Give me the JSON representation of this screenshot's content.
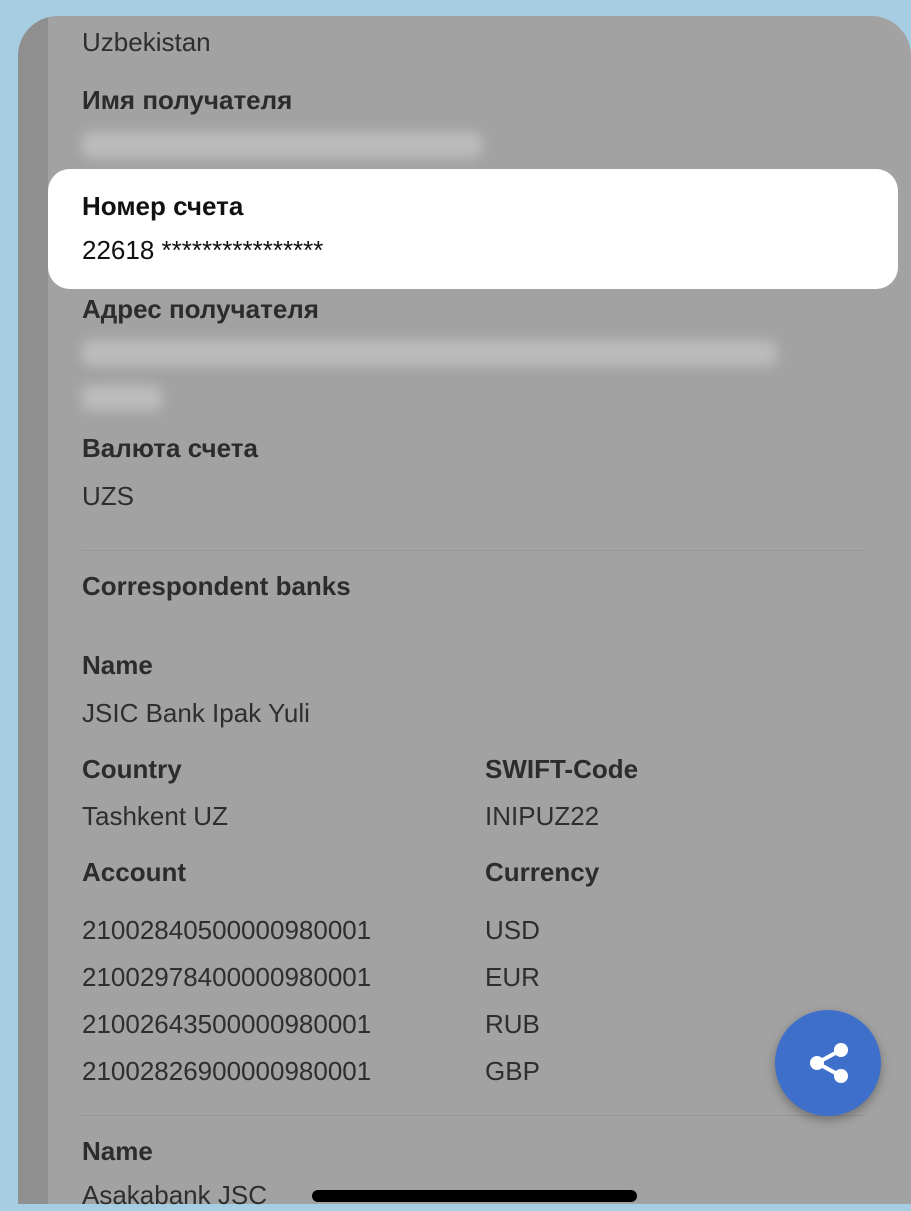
{
  "top_country": "Uzbekistan",
  "recipient_name_label": "Имя получателя",
  "account_number": {
    "label": "Номер счета",
    "value": "22618 ****************"
  },
  "recipient_address_label": "Адрес получателя",
  "account_currency": {
    "label": "Валюта счета",
    "value": "UZS"
  },
  "correspondent_banks": {
    "title": "Correspondent banks",
    "bank1": {
      "name_label": "Name",
      "name_value": "JSIC Bank Ipak Yuli",
      "country_label": "Country",
      "country_value": "Tashkent UZ",
      "swift_label": "SWIFT-Code",
      "swift_value": "INIPUZ22",
      "account_label": "Account",
      "currency_label": "Currency",
      "accounts": [
        {
          "account": "21002840500000980001",
          "currency": "USD"
        },
        {
          "account": "21002978400000980001",
          "currency": "EUR"
        },
        {
          "account": "21002643500000980001",
          "currency": "RUB"
        },
        {
          "account": "21002826900000980001",
          "currency": "GBP"
        }
      ]
    },
    "bank2": {
      "name_label": "Name",
      "name_value": "Asakabank JSC"
    }
  },
  "share_button": {
    "icon": "share-icon"
  },
  "colors": {
    "accent": "#3e6fcb",
    "overlay": "#a2a2a2",
    "background": "#a7cde2"
  }
}
